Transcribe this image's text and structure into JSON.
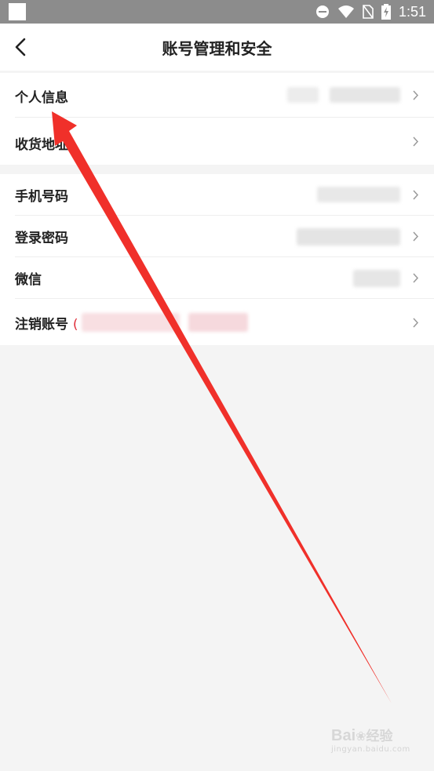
{
  "status_bar": {
    "time": "1:51"
  },
  "header": {
    "title": "账号管理和安全"
  },
  "group1": [
    {
      "label": "个人信息"
    },
    {
      "label": "收货地址"
    }
  ],
  "group2": [
    {
      "label": "手机号码"
    },
    {
      "label": "登录密码"
    },
    {
      "label": "微信"
    },
    {
      "label": "注销账号",
      "note_open": "("
    }
  ],
  "watermark": {
    "brand": "Bai",
    "brand_suffix": "经验",
    "url": "jingyan.baidu.com"
  },
  "colors": {
    "background": "#f4f4f4",
    "status_bar": "#8c8c8c",
    "arrow": "#f0302a",
    "warning": "#e0303c"
  }
}
